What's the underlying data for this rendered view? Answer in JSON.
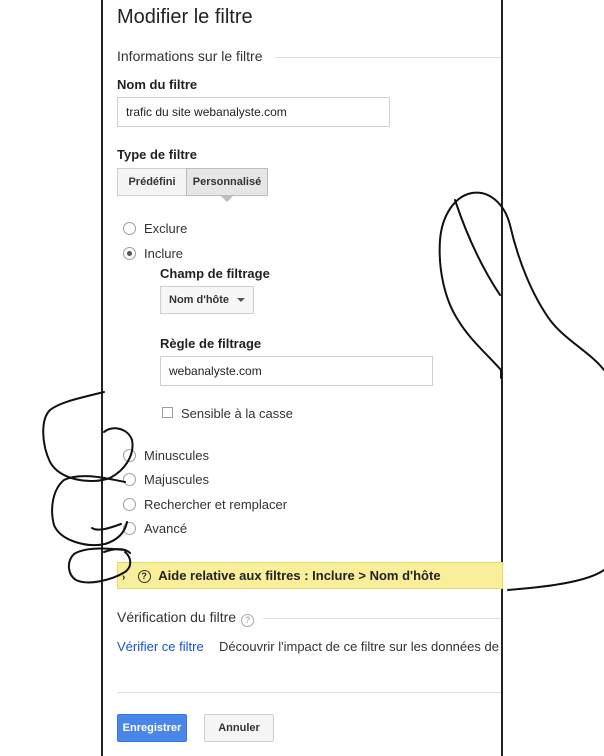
{
  "page_title": "Modifier le filtre",
  "info_section": {
    "heading": "Informations sur le filtre",
    "filter_name_label": "Nom du filtre",
    "filter_name_value": "trafic du site webanalyste.com",
    "filter_type_label": "Type de filtre",
    "filter_type_tabs": [
      {
        "label": "Prédéfini",
        "active": false
      },
      {
        "label": "Personnalisé",
        "active": true
      }
    ],
    "type_options": [
      {
        "label": "Exclure",
        "selected": false
      },
      {
        "label": "Inclure",
        "selected": true
      }
    ],
    "filter_field_label": "Champ de filtrage",
    "filter_field_value": "Nom d'hôte",
    "filter_rule_label": "Règle de filtrage",
    "filter_rule_value": "webanalyste.com",
    "case_sensitive_label": "Sensible à la casse",
    "other_options": [
      "Minuscules",
      "Majuscules",
      "Rechercher et remplacer",
      "Avancé"
    ]
  },
  "help_bar": {
    "text": "Aide relative aux filtres : Inclure  >  Nom d'hôte"
  },
  "verification": {
    "heading": "Vérification du filtre",
    "link": "Vérifier ce filtre",
    "description": "Découvrir l'impact de ce filtre sur les données de"
  },
  "buttons": {
    "save": "Enregistrer",
    "cancel": "Annuler"
  },
  "colors": {
    "primary_button": "#4a86e8",
    "help_bar": "#f9ef9a",
    "link": "#1155cc"
  }
}
